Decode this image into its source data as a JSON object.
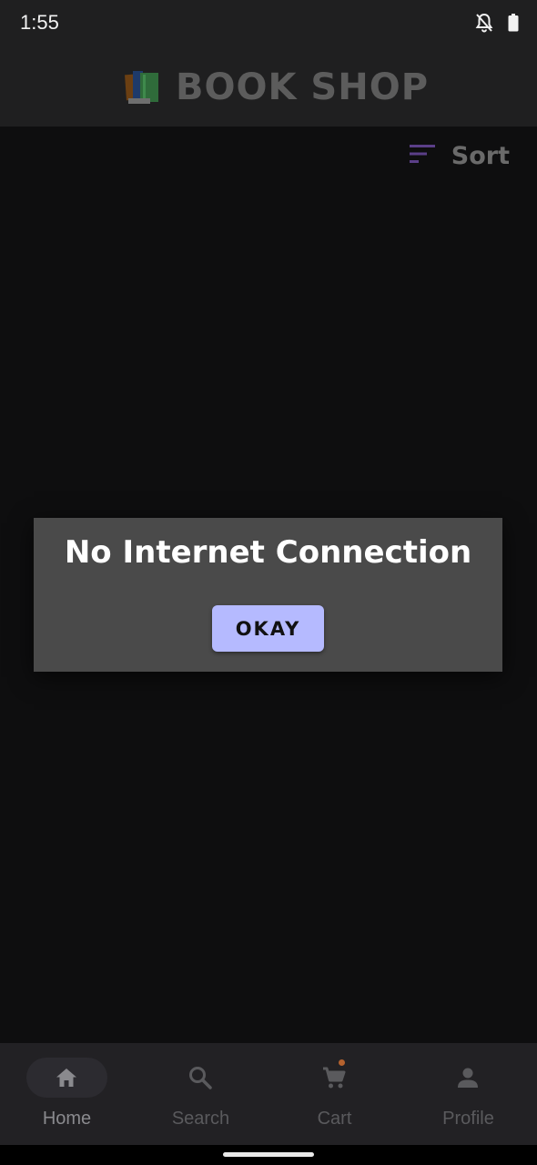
{
  "status_bar": {
    "time": "1:55",
    "icons": [
      "notifications-off-icon",
      "battery-icon"
    ]
  },
  "app_bar": {
    "title": "BOOK SHOP",
    "logo_icon": "books-icon"
  },
  "toolbar": {
    "sort_label": "Sort",
    "sort_icon": "sort-icon",
    "sort_icon_color": "#5b3f88"
  },
  "dialog": {
    "title": "No Internet Connection",
    "button_label": "OKAY",
    "button_color": "#b5baff"
  },
  "bottom_nav": {
    "items": [
      {
        "label": "Home",
        "icon": "home-icon",
        "active": true
      },
      {
        "label": "Search",
        "icon": "search-icon",
        "active": false
      },
      {
        "label": "Cart",
        "icon": "cart-icon",
        "active": false,
        "badge_dot": true
      },
      {
        "label": "Profile",
        "icon": "person-icon",
        "active": false
      }
    ]
  },
  "colors": {
    "background": "#0e0e0f",
    "bar_background": "#1f1f20",
    "dialog_background": "#4a4a4a",
    "nav_background": "#222124"
  }
}
